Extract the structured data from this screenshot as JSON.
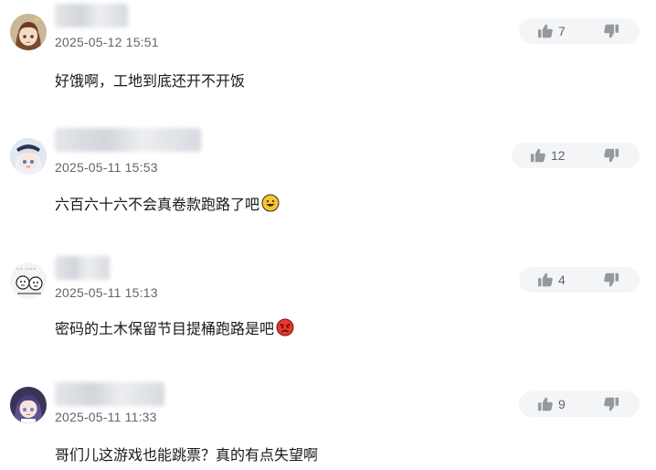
{
  "comments": [
    {
      "avatar": "anime-girl-brown-hair-avatar",
      "time": "2025-05-12 15:51",
      "text": "好饿啊，工地到底还开不开饭",
      "emoji": "",
      "likes": "7",
      "like_icon": "thumbs-up-icon",
      "dislike_icon": "thumbs-down-icon"
    },
    {
      "avatar": "anime-girl-white-hair-avatar",
      "time": "2025-05-11 15:53",
      "text": "六百六十六不会真卷款跑路了吧",
      "emoji": "grinning-emoji",
      "likes": "12",
      "like_icon": "thumbs-up-icon",
      "dislike_icon": "thumbs-down-icon"
    },
    {
      "avatar": "sketch-cartoon-avatar",
      "time": "2025-05-11 15:13",
      "text": "密码的土木保留节目提桶跑路是吧",
      "emoji": "angry-emoji",
      "likes": "4",
      "like_icon": "thumbs-up-icon",
      "dislike_icon": "thumbs-down-icon"
    },
    {
      "avatar": "anime-girl-purple-hair-avatar",
      "time": "2025-05-11 11:33",
      "text": "哥们儿这游戏也能跳票？真的有点失望啊",
      "emoji": "",
      "likes": "9",
      "like_icon": "thumbs-up-icon",
      "dislike_icon": "thumbs-down-icon"
    }
  ],
  "colors": {
    "text": "#18191c",
    "meta": "#61666d",
    "vote_bg": "#f4f5f7",
    "icon": "#9499a0",
    "emoji_yellow": "#f7c531",
    "emoji_red": "#e8372b"
  }
}
